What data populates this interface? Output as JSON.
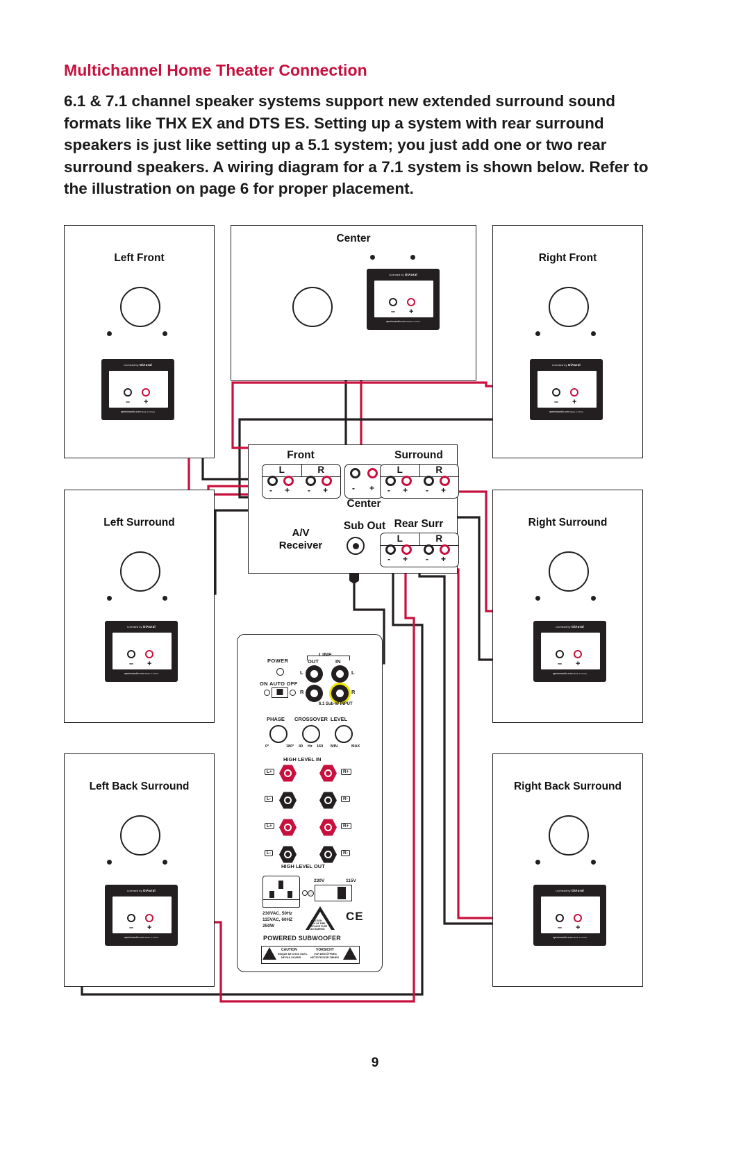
{
  "page": {
    "heading": "Multichannel Home Theater Connection",
    "body": "6.1 & 7.1 channel speaker systems support new extended surround sound formats like THX EX and DTS ES. Setting up a system with rear surround speakers is just like setting up a 5.1 system; you just add one or two rear surround speakers. A wiring diagram for a 7.1 system is shown below. Refer to the illustration on page 6 for proper placement.",
    "folio": "9",
    "accent_color": "#c8103e",
    "text_color": "#1a1a1a"
  },
  "speakers": [
    {
      "id": "left-front",
      "label": "Left Front"
    },
    {
      "id": "center",
      "label": "Center"
    },
    {
      "id": "right-front",
      "label": "Right Front"
    },
    {
      "id": "left-surround",
      "label": "Left Surround"
    },
    {
      "id": "right-surround",
      "label": "Right Surround"
    },
    {
      "id": "left-back-surround",
      "label": "Left Back Surround"
    },
    {
      "id": "right-back-surround",
      "label": "Right Back Surround"
    }
  ],
  "terminal_cup": {
    "licensed_text": "Licensed by",
    "brand": "DiAural",
    "company": "aperionaudio.com",
    "made_in": "Made in China",
    "minus": "–",
    "plus": "+"
  },
  "receiver": {
    "title_line1": "A/V",
    "title_line2": "Receiver",
    "groups": [
      {
        "id": "front",
        "label": "Front",
        "channels": [
          "L",
          "R"
        ]
      },
      {
        "id": "surround",
        "label": "Surround",
        "channels": [
          "L",
          "R"
        ]
      },
      {
        "id": "rear-surr",
        "label": "Rear Surr",
        "channels": [
          "L",
          "R"
        ]
      }
    ],
    "center_label": "Center",
    "sub_out_label": "Sub Out",
    "minus": "-",
    "plus": "+"
  },
  "subwoofer": {
    "power_label": "POWER",
    "mode_switch": "ON AUTO OFF",
    "mode_options": [
      "ON",
      "AUTO",
      "OFF"
    ],
    "line_label": "LINE",
    "line_out": "OUT",
    "line_in": "IN",
    "channel_left": "L",
    "channel_right": "R",
    "lfe_label": "6.1 Sub-W INPUT",
    "knobs": [
      {
        "name": "PHASE",
        "min": "0°",
        "max": "180°"
      },
      {
        "name": "CROSSOVER",
        "min": "40",
        "mid": "Hz",
        "max": "160"
      },
      {
        "name": "LEVEL",
        "min": "MIN",
        "max": "MAX"
      }
    ],
    "high_level_in": "HIGH LEVEL IN",
    "high_level_out": "HIGH LEVEL OUT",
    "post_tags_left": [
      "L+",
      "L-",
      "L+",
      "L-"
    ],
    "post_tags_right": [
      "R+",
      "R-",
      "R+",
      "R-"
    ],
    "voltage_230": "230V",
    "voltage_115": "115V",
    "ratings_line1": "230VAC, 50Hz",
    "ratings_line2": "115VAC, 60HZ",
    "ratings_line3": "250W",
    "fuse_warning_line1": "CAUTION",
    "fuse_warning_line2": "RISK OF FIRE",
    "fuse_warning_line3": "REPLACE FUSE",
    "fuse_warning_line4": "AS MARKED",
    "ce_mark": "CE",
    "product_label": "POWERED SUBWOOFER",
    "caution_en_title": "CAUTION",
    "caution_en_line1": "RISQUE DE CHOC ELEC.",
    "caution_en_line2": "NE PAS OUVRIR",
    "caution_de_title": "VORSICHT",
    "caution_de_line1": "VOR DEM ÖFFNEN",
    "caution_de_line2": "NETZSTECKER ZIEHEN"
  },
  "wires": {
    "positive_color": "#c8103e",
    "negative_color": "#231f20"
  }
}
